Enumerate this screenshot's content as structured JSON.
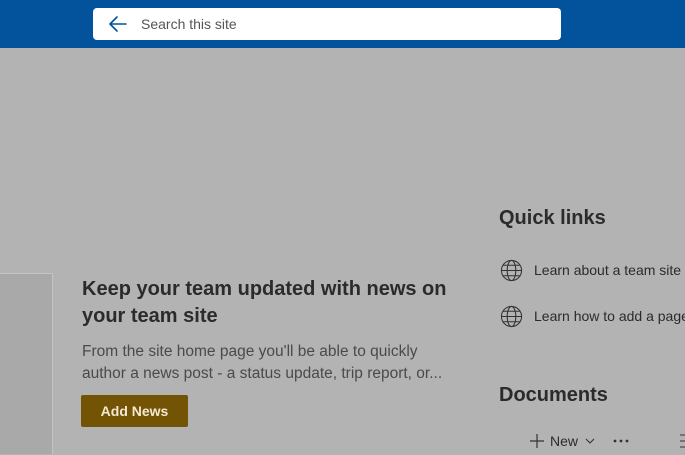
{
  "search": {
    "placeholder": "Search this site",
    "back_icon": "back-arrow-icon"
  },
  "news": {
    "heading": "Keep your team updated with news on your team site",
    "description": "From the site home page you'll be able to quickly author a news post - a status update, trip report, or...",
    "add_button": "Add News"
  },
  "quick_links": {
    "title": "Quick links",
    "items": [
      {
        "label": "Learn about a team site",
        "icon": "globe-icon"
      },
      {
        "label": "Learn how to add a page",
        "icon": "globe-icon"
      }
    ]
  },
  "documents": {
    "title": "Documents",
    "toolbar": {
      "new_label": "New",
      "new_icon": "plus-icon",
      "dropdown_icon": "chevron-down-icon",
      "more_icon": "more-options-icon"
    }
  },
  "colors": {
    "header": "#03529c",
    "overlay": "#b3b3b3",
    "accent_button": "#735405"
  }
}
